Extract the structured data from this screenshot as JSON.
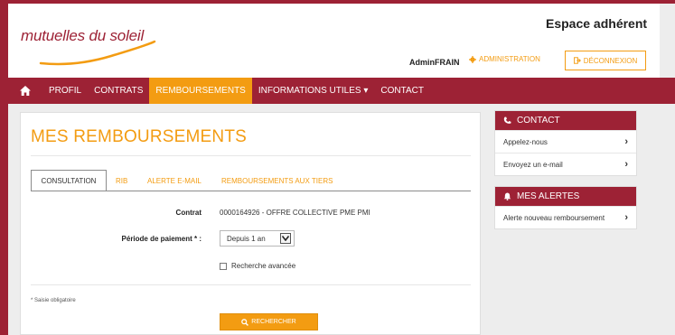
{
  "header": {
    "logo_text": "mutuelles du soleil",
    "title": "Espace adhérent",
    "user": "AdminFRAIN",
    "admin_label": "ADMINISTRATION",
    "logout_label": "DÉCONNEXION"
  },
  "nav": {
    "items": [
      {
        "label": "PROFIL"
      },
      {
        "label": "CONTRATS"
      },
      {
        "label": "REMBOURSEMENTS"
      },
      {
        "label": "INFORMATIONS UTILES ▾"
      },
      {
        "label": "CONTACT"
      }
    ],
    "active": "REMBOURSEMENTS"
  },
  "main": {
    "title": "MES REMBOURSEMENTS",
    "tabs": [
      {
        "label": "CONSULTATION"
      },
      {
        "label": "RIB"
      },
      {
        "label": "ALERTE E-MAIL"
      },
      {
        "label": "REMBOURSEMENTS AUX TIERS"
      }
    ],
    "contrat_label": "Contrat",
    "contrat_value": "0000164926 - OFFRE COLLECTIVE PME PMI",
    "periode_label": "Période de paiement * :",
    "periode_value": "Depuis 1 an",
    "advanced_label": "Recherche avancée",
    "mandatory_note": "* Saisie obligatoire",
    "search_label": "RECHERCHER"
  },
  "sidebar": {
    "contact_title": "CONTACT",
    "contact_items": [
      {
        "label": "Appelez-nous"
      },
      {
        "label": "Envoyez un e-mail"
      }
    ],
    "alerts_title": "MES ALERTES",
    "alert_items": [
      {
        "label": "Alerte nouveau remboursement"
      }
    ]
  },
  "colors": {
    "brand": "#9d2235",
    "accent": "#f39c12"
  }
}
